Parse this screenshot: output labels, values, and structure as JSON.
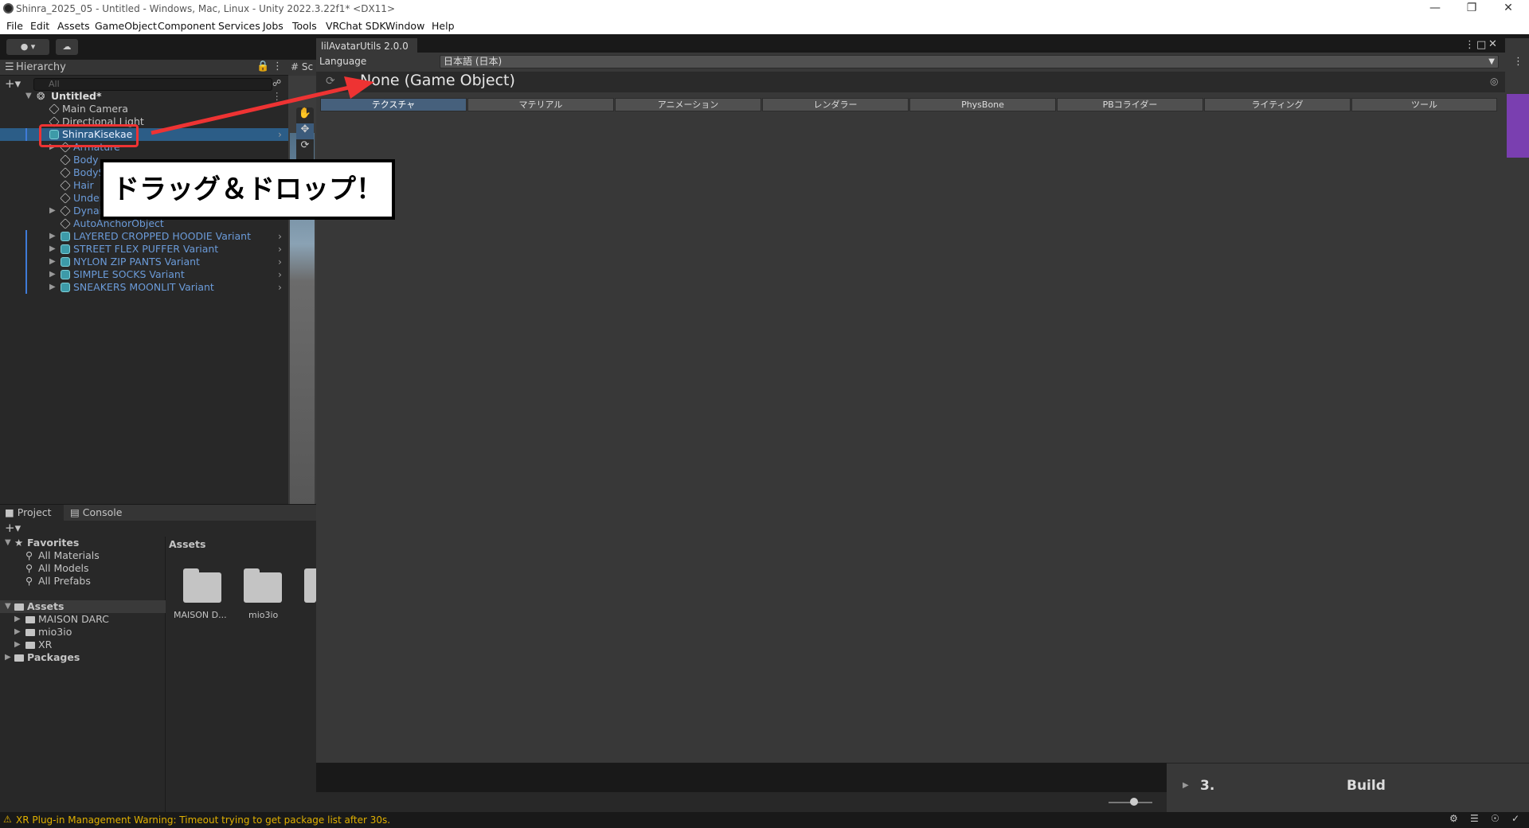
{
  "window": {
    "title": "Shinra_2025_05 - Untitled - Windows, Mac, Linux - Unity 2022.3.22f1* <DX11>"
  },
  "menu": [
    "File",
    "Edit",
    "Assets",
    "GameObject",
    "Component",
    "Services",
    "Jobs",
    "Tools",
    "VRChat SDK",
    "Window",
    "Help"
  ],
  "hierarchy": {
    "tab": "Hierarchy",
    "search_placeholder": "All",
    "scene": "Untitled*",
    "items": [
      {
        "label": "Main Camera"
      },
      {
        "label": "Directional Light"
      },
      {
        "label": "ShinraKisekae"
      },
      {
        "label": "Armature"
      },
      {
        "label": "Body"
      },
      {
        "label": "BodyS"
      },
      {
        "label": "Hair"
      },
      {
        "label": "Under"
      },
      {
        "label": "Dynai"
      },
      {
        "label": "AutoAnchorObject"
      },
      {
        "label": "LAYERED CROPPED HOODIE Variant"
      },
      {
        "label": "STREET FLEX PUFFER Variant"
      },
      {
        "label": "NYLON ZIP PANTS Variant"
      },
      {
        "label": "SIMPLE SOCKS Variant"
      },
      {
        "label": "SNEAKERS MOONLIT Variant"
      }
    ]
  },
  "scene_tab": "Sc",
  "project": {
    "tabs": [
      "Project",
      "Console"
    ],
    "favorites": {
      "label": "Favorites",
      "items": [
        "All Materials",
        "All Models",
        "All Prefabs"
      ]
    },
    "assets": {
      "label": "Assets",
      "items": [
        "MAISON DARC",
        "mio3io",
        "XR"
      ]
    },
    "packages": "Packages",
    "right_header": "Assets",
    "folders": [
      "MAISON D...",
      "mio3io"
    ]
  },
  "tool": {
    "tab": "lilAvatarUtils 2.0.0",
    "language_label": "Language",
    "language_value": "日本語 (日本)",
    "object_field": "None (Game Object)",
    "tabs": [
      "テクスチャ",
      "マテリアル",
      "アニメーション",
      "レンダラー",
      "PhysBone",
      "PBコライダー",
      "ライティング",
      "ツール"
    ]
  },
  "build": {
    "step": "3.",
    "label": "Build"
  },
  "status": {
    "message": "XR Plug-in Management Warning: Timeout trying to get package list after 30s."
  },
  "annotation": {
    "callout": "ドラッグ＆ドロップ！",
    "color": "#e33"
  }
}
